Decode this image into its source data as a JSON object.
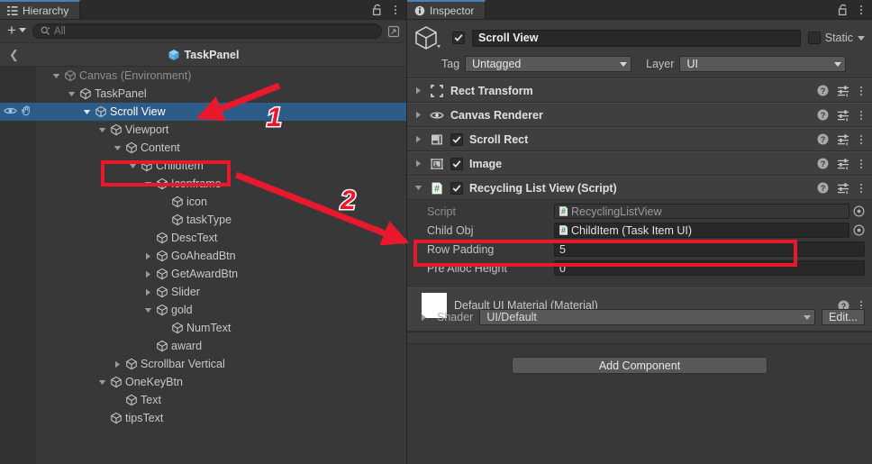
{
  "hierarchy": {
    "tab_label": "Hierarchy",
    "tab_icon": "hierarchy-icon",
    "lock_icon": "lock-open-icon",
    "menu_icon": "kebab-menu-icon",
    "toolbar": {
      "add_label": "+",
      "add_icon": "plus-icon",
      "search_value": "All",
      "search_placeholder": "All",
      "search_icon": "search-icon",
      "expand_icon": "open-in-new-icon"
    },
    "breadcrumb": {
      "back_icon": "chevron-left-icon",
      "prefab_icon": "prefab-cube-icon",
      "label": "TaskPanel"
    },
    "items": [
      {
        "label": "Canvas (Environment)",
        "depth": 1,
        "twisty": "open",
        "dim": true,
        "selected": false
      },
      {
        "label": "TaskPanel",
        "depth": 2,
        "twisty": "open",
        "dim": false,
        "selected": false
      },
      {
        "label": "Scroll View",
        "depth": 3,
        "twisty": "open",
        "dim": false,
        "selected": true,
        "visibility_icon": "eye-icon",
        "pickability_icon": "hand-pointer-icon"
      },
      {
        "label": "Viewport",
        "depth": 4,
        "twisty": "open",
        "dim": false,
        "selected": false
      },
      {
        "label": "Content",
        "depth": 5,
        "twisty": "open",
        "dim": false,
        "selected": false
      },
      {
        "label": "ChildItem",
        "depth": 6,
        "twisty": "open",
        "dim": false,
        "selected": false,
        "highlighted": true
      },
      {
        "label": "Iconframe",
        "depth": 7,
        "twisty": "open",
        "dim": false,
        "selected": false
      },
      {
        "label": "icon",
        "depth": 8,
        "twisty": "none",
        "dim": false,
        "selected": false
      },
      {
        "label": "taskType",
        "depth": 8,
        "twisty": "none",
        "dim": false,
        "selected": false
      },
      {
        "label": "DescText",
        "depth": 7,
        "twisty": "none",
        "dim": false,
        "selected": false
      },
      {
        "label": "GoAheadBtn",
        "depth": 7,
        "twisty": "closed",
        "dim": false,
        "selected": false
      },
      {
        "label": "GetAwardBtn",
        "depth": 7,
        "twisty": "closed",
        "dim": false,
        "selected": false
      },
      {
        "label": "Slider",
        "depth": 7,
        "twisty": "closed",
        "dim": false,
        "selected": false
      },
      {
        "label": "gold",
        "depth": 7,
        "twisty": "open",
        "dim": false,
        "selected": false
      },
      {
        "label": "NumText",
        "depth": 8,
        "twisty": "none",
        "dim": false,
        "selected": false
      },
      {
        "label": "award",
        "depth": 7,
        "twisty": "none",
        "dim": false,
        "selected": false
      },
      {
        "label": "Scrollbar Vertical",
        "depth": 5,
        "twisty": "closed",
        "dim": false,
        "selected": false
      },
      {
        "label": "OneKeyBtn",
        "depth": 4,
        "twisty": "open",
        "dim": false,
        "selected": false
      },
      {
        "label": "Text",
        "depth": 5,
        "twisty": "none",
        "dim": false,
        "selected": false
      },
      {
        "label": "tipsText",
        "depth": 4,
        "twisty": "none",
        "dim": false,
        "selected": false
      }
    ]
  },
  "inspector": {
    "tab_label": "Inspector",
    "tab_icon": "info-icon",
    "lock_icon": "lock-open-icon",
    "menu_icon": "kebab-menu-icon",
    "object_header": {
      "gameobject_icon": "gameobject-cube-icon",
      "enabled": true,
      "name": "Scroll View",
      "static_label": "Static",
      "static_checked": false,
      "tag_label": "Tag",
      "tag_value": "Untagged",
      "layer_label": "Layer",
      "layer_value": "UI"
    },
    "components": [
      {
        "name": "Rect Transform",
        "icon": "rect-transform-icon",
        "twisty": "closed",
        "has_checkbox": false
      },
      {
        "name": "Canvas Renderer",
        "icon": "canvas-renderer-eye-icon",
        "twisty": "closed",
        "has_checkbox": false
      },
      {
        "name": "Scroll Rect",
        "icon": "scroll-rect-icon",
        "twisty": "closed",
        "has_checkbox": true,
        "checked": true
      },
      {
        "name": "Image",
        "icon": "image-icon",
        "twisty": "closed",
        "has_checkbox": true,
        "checked": true
      },
      {
        "name": "Recycling List View (Script)",
        "icon": "script-icon",
        "twisty": "open",
        "has_checkbox": true,
        "checked": true
      }
    ],
    "component_actions": {
      "help_icon": "help-circle-icon",
      "preset_icon": "preset-sliders-icon",
      "menu_icon": "kebab-menu-icon"
    },
    "script_properties": [
      {
        "label": "Script",
        "type": "object",
        "value": "RecyclingListView",
        "icon": "script-icon",
        "disabled": true,
        "highlighted": false
      },
      {
        "label": "Child Obj",
        "type": "object",
        "value": "ChildItem (Task Item UI)",
        "icon": "script-icon",
        "disabled": false,
        "highlighted": true
      },
      {
        "label": "Row Padding",
        "type": "number",
        "value": "5"
      },
      {
        "label": "Pre Alloc Height",
        "type": "number",
        "value": "0"
      }
    ],
    "material": {
      "title": "Default UI Material (Material)",
      "swatch_color": "#ffffff",
      "shader_label": "Shader",
      "shader_value": "UI/Default",
      "edit_label": "Edit...",
      "help_icon": "help-circle-icon",
      "menu_icon": "kebab-menu-icon",
      "twisty": "closed"
    },
    "add_component_label": "Add Component"
  },
  "annotations": {
    "accent_color": "#e8192c",
    "outline_color": "#ffffff",
    "markers": [
      {
        "number": "1",
        "points_to": "Scroll View hierarchy row"
      },
      {
        "number": "2",
        "points_to": "Child Obj field"
      }
    ],
    "boxes": [
      {
        "target": "ChildItem hierarchy row"
      },
      {
        "target": "Child Obj property row"
      }
    ]
  },
  "theme": {
    "window_bg": "#383838",
    "tabbar_bg": "#2b2b2b",
    "selection_blue": "#2c5c87",
    "prefab_blue": "#5fb4e8",
    "field_bg": "#282828",
    "button_bg": "#585858",
    "script_green": "#4caf50"
  }
}
